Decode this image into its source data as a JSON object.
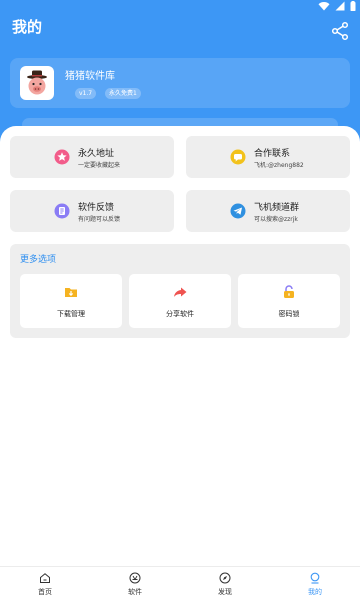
{
  "header": {
    "title": "我的"
  },
  "profile": {
    "app_name": "猪猪软件库",
    "tags": [
      "v1.7",
      "永久免费1"
    ]
  },
  "quick_links": [
    {
      "title": "永久地址",
      "subtitle": "一定要收藏起来",
      "icon": "star-icon",
      "color": "#f25c8a"
    },
    {
      "title": "合作联系",
      "subtitle": "飞机:@zheng882",
      "icon": "chat-bubble-icon",
      "color": "#f2c21b"
    },
    {
      "title": "软件反馈",
      "subtitle": "有问题可以反馈",
      "icon": "feedback-icon",
      "color": "#8a7cf5"
    },
    {
      "title": "飞机频道群",
      "subtitle": "可以搜索@zzrjk",
      "icon": "telegram-icon",
      "color": "#2f90e0"
    }
  ],
  "more_options": {
    "title": "更多选项",
    "items": [
      {
        "label": "下载管理",
        "icon": "download-folder-icon",
        "color": "#f5b321"
      },
      {
        "label": "分享软件",
        "icon": "share-arrow-icon",
        "color": "#ef5350"
      },
      {
        "label": "密码锁",
        "icon": "lock-icon",
        "color": "#f5b321"
      }
    ]
  },
  "tabbar": {
    "active": "我的",
    "items": [
      {
        "label": "首页",
        "icon": "home-icon"
      },
      {
        "label": "软件",
        "icon": "app-store-icon"
      },
      {
        "label": "发现",
        "icon": "compass-icon"
      },
      {
        "label": "我的",
        "icon": "profile-icon"
      }
    ]
  },
  "colors": {
    "primary": "#3d97f5",
    "card_bg": "#eeeeee",
    "accent_text": "#2f8ff0"
  }
}
